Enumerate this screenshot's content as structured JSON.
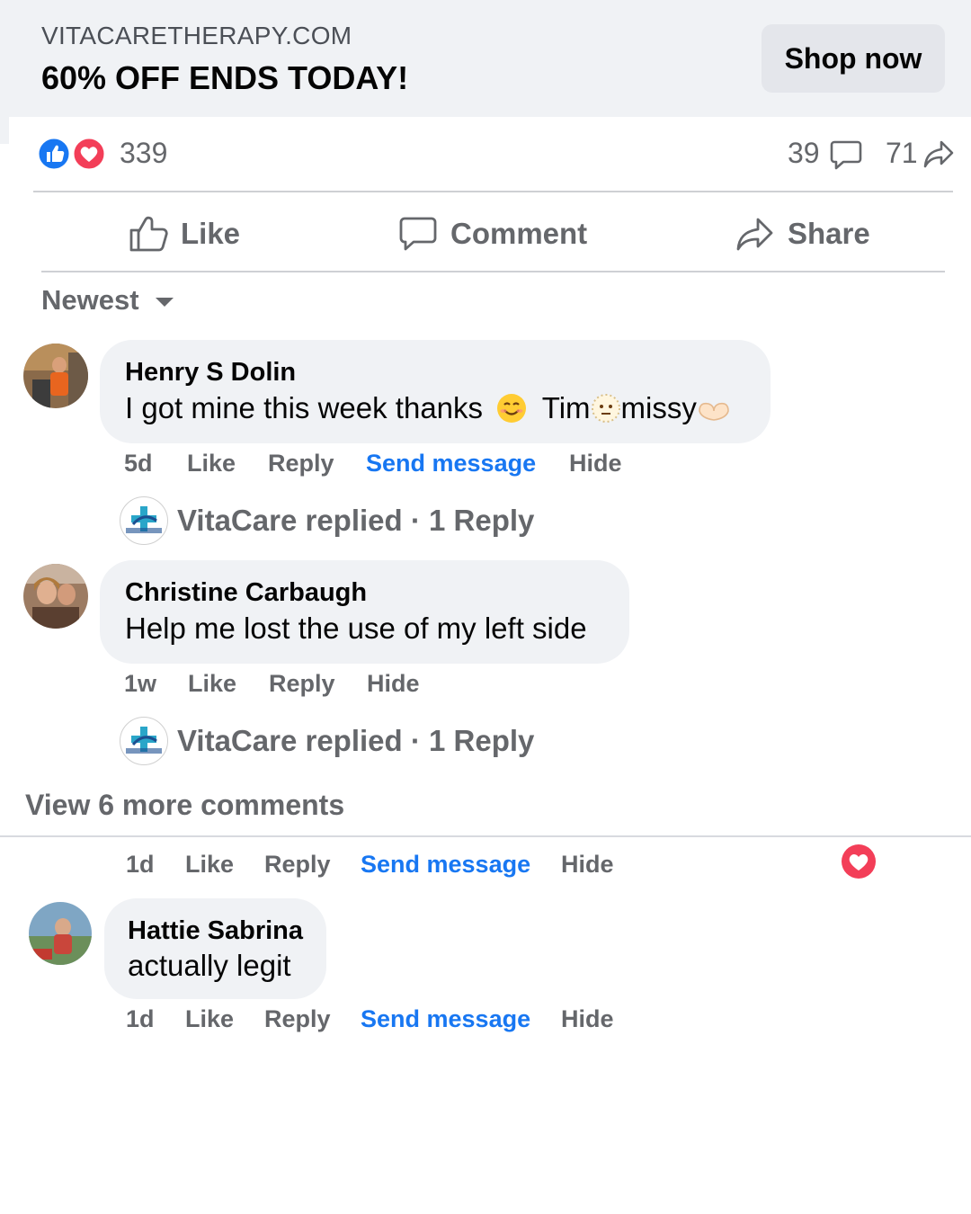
{
  "ad": {
    "domain": "VITACARETHERAPY.COM",
    "headline": "60% OFF ENDS TODAY!",
    "cta": "Shop now"
  },
  "stats": {
    "reactions": "339",
    "comments": "39",
    "shares": "71"
  },
  "actions": {
    "like": "Like",
    "comment": "Comment",
    "share": "Share"
  },
  "sort": {
    "label": "Newest"
  },
  "comments": [
    {
      "name": "Henry S Dolin",
      "text_a": "I got mine this week thanks",
      "text_b": "Tim",
      "text_c": "missy",
      "time": "5d",
      "like": "Like",
      "reply": "Reply",
      "send": "Send message",
      "hide": "Hide",
      "replies": "VitaCare replied · 1 Reply"
    },
    {
      "name": "Christine Carbaugh",
      "text": "Help me lost the use of my left side",
      "time": "1w",
      "like": "Like",
      "reply": "Reply",
      "hide": "Hide",
      "replies": "VitaCare replied · 1 Reply"
    }
  ],
  "view_more": "View 6 more comments",
  "lower": {
    "meta": {
      "time": "1d",
      "like": "Like",
      "reply": "Reply",
      "send": "Send message",
      "hide": "Hide"
    },
    "comment": {
      "name": "Hattie Sabrina",
      "text": "actually legit",
      "time": "1d",
      "like": "Like",
      "reply": "Reply",
      "send": "Send message",
      "hide": "Hide"
    }
  },
  "colors": {
    "link_blue": "#1877f2",
    "meta_grey": "#65676b",
    "bubble_bg": "#f0f2f5",
    "like_blue": "#1877f2",
    "love_red": "#f33e58"
  }
}
